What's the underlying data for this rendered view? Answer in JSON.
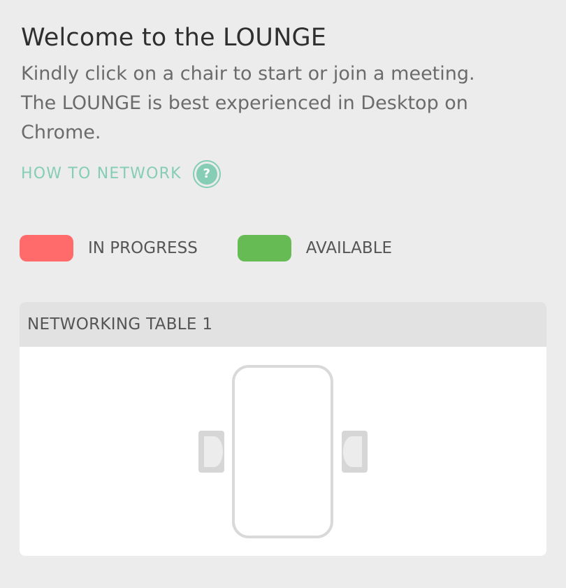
{
  "header": {
    "title": "Welcome to the LOUNGE",
    "subtitle_lines": [
      "Kindly click on a chair to start or join a meeting.",
      "The LOUNGE is best experienced in Desktop on",
      "Chrome."
    ]
  },
  "help_link": {
    "label": "HOW TO NETWORK",
    "icon": "help-circle-icon",
    "icon_glyph": "?",
    "color": "#86cdb6"
  },
  "legend": [
    {
      "label": "IN PROGRESS",
      "color": "#ff6b6b"
    },
    {
      "label": "AVAILABLE",
      "color": "#66bb55"
    }
  ],
  "tables": [
    {
      "name": "NETWORKING TABLE 1",
      "chairs": [
        {
          "side": "left",
          "status": "empty"
        },
        {
          "side": "right",
          "status": "empty"
        }
      ],
      "colors": {
        "table_outline": "#d9d9d9",
        "chair_fill": "#d6d6d6"
      }
    }
  ]
}
